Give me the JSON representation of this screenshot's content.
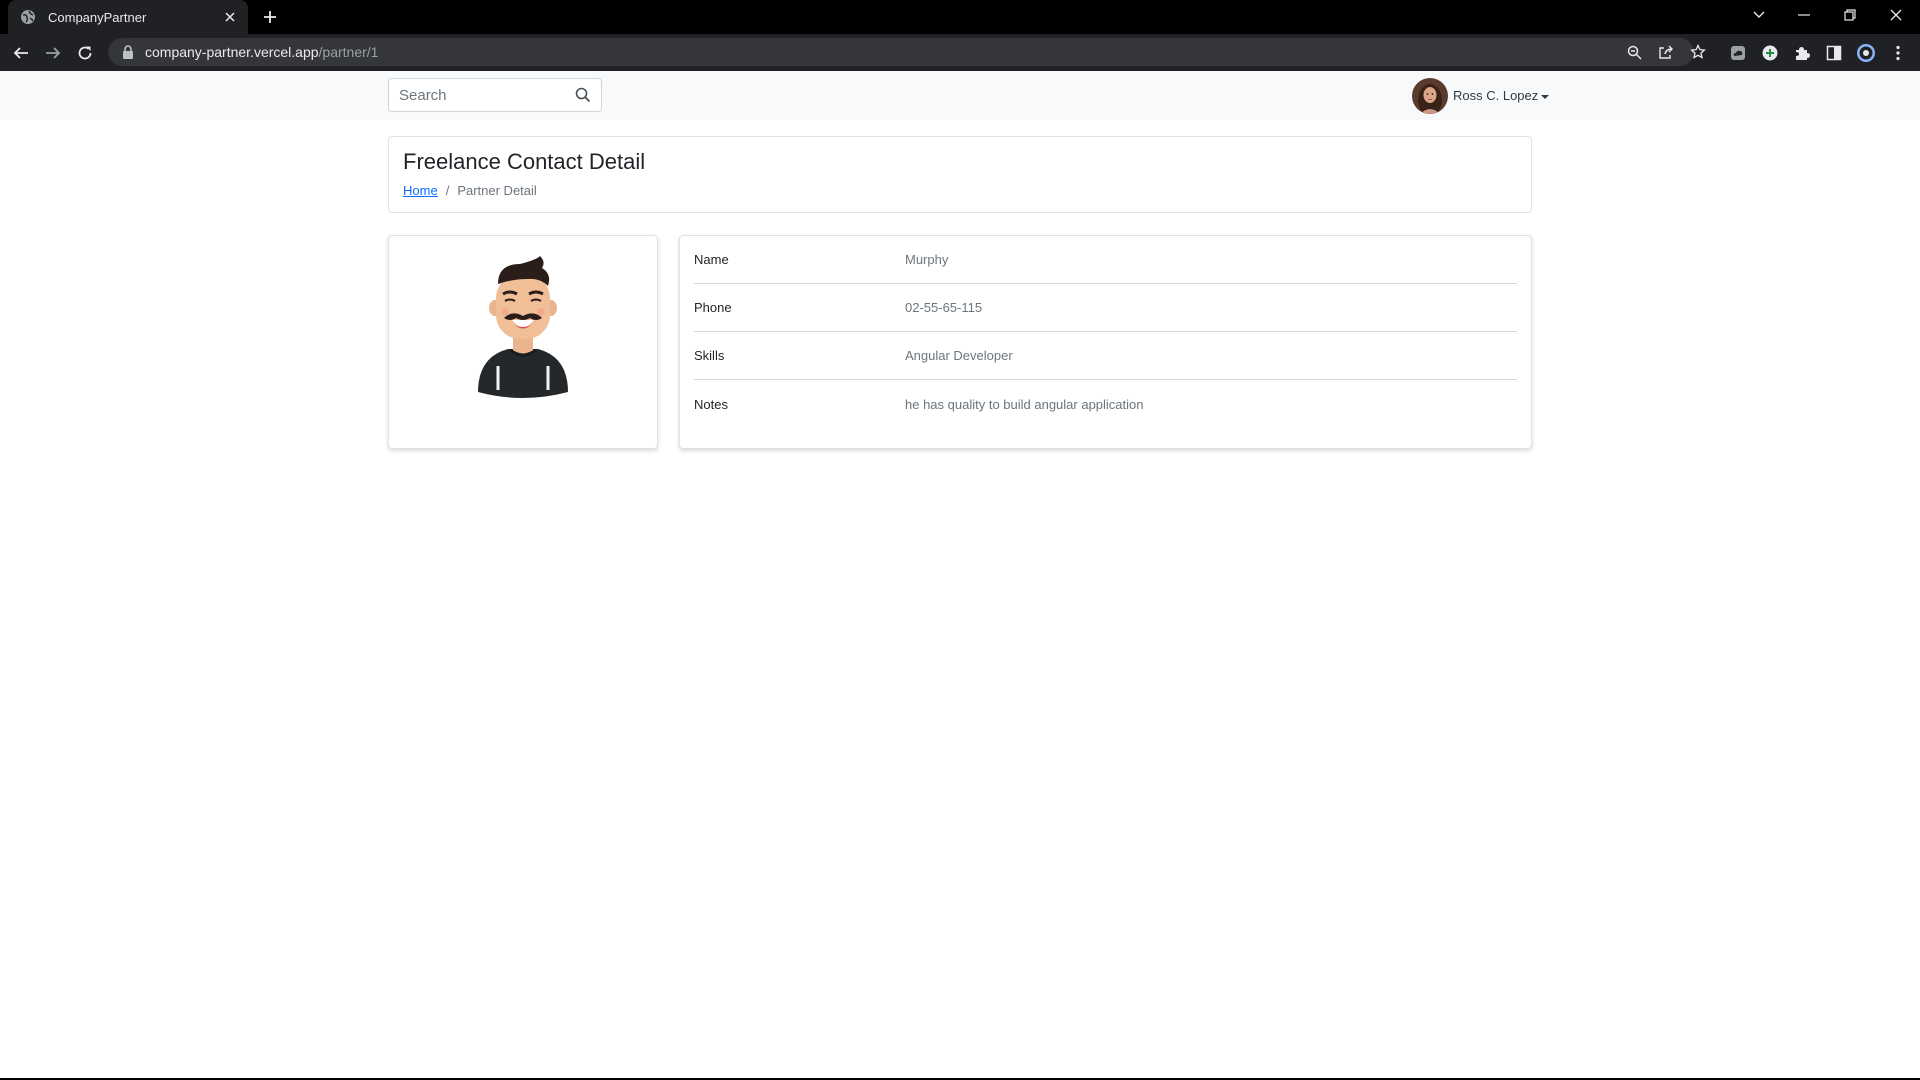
{
  "browser": {
    "tab_title": "CompanyPartner",
    "url_host": "company-partner.vercel.app",
    "url_path": "/partner/1"
  },
  "navbar": {
    "search_placeholder": "Search",
    "search_value": "",
    "user_name": "Ross C. Lopez"
  },
  "header": {
    "title": "Freelance Contact Detail",
    "breadcrumb": {
      "home": "Home",
      "separator": "/",
      "current": "Partner Detail"
    }
  },
  "partner": {
    "rows": [
      {
        "label": "Name",
        "value": "Murphy"
      },
      {
        "label": "Phone",
        "value": "02-55-65-115"
      },
      {
        "label": "Skills",
        "value": "Angular Developer"
      },
      {
        "label": "Notes",
        "value": "he has quality to build angular application"
      }
    ]
  },
  "colors": {
    "link": "#0d6efd",
    "navbar_bg": "#f8f9fa",
    "muted_text": "#6c757d"
  },
  "icons": {
    "tab_favicon": "globe-icon",
    "search": "search-icon",
    "lock": "lock-icon"
  }
}
